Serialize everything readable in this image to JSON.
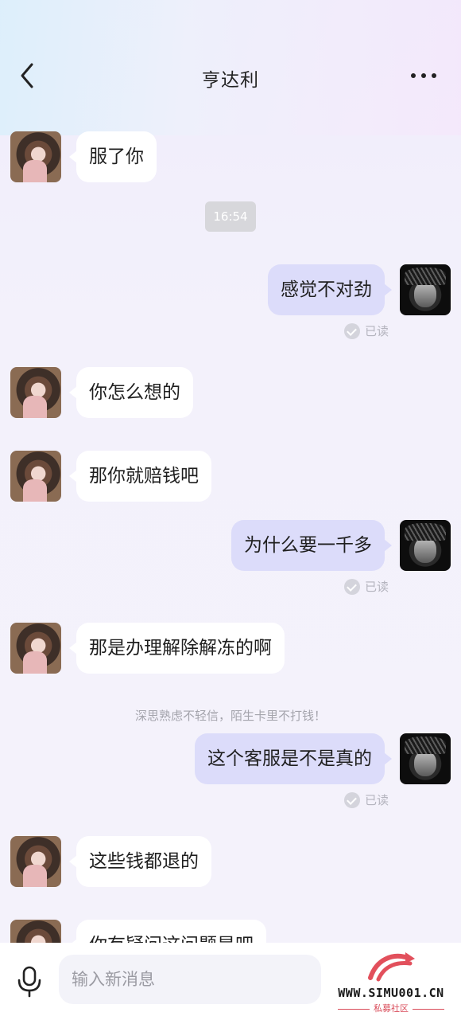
{
  "header": {
    "title": "亨达利"
  },
  "messages": [
    {
      "side": "in",
      "text": "服了你"
    },
    {
      "timestamp": "16:54"
    },
    {
      "side": "out",
      "text": "感觉不对劲",
      "status": "已读"
    },
    {
      "side": "in",
      "text": "你怎么想的"
    },
    {
      "side": "in",
      "text": "那你就赔钱吧"
    },
    {
      "side": "out",
      "text": "为什么要一千多",
      "status": "已读"
    },
    {
      "side": "in",
      "text": "那是办理解除解冻的啊"
    },
    {
      "notice": "深思熟虑不轻信，陌生卡里不打钱！"
    },
    {
      "side": "out",
      "text": "这个客服是不是真的",
      "status": "已读"
    },
    {
      "side": "in",
      "text": "这些钱都退的"
    },
    {
      "side": "in",
      "text": "你有疑问这问题是吧"
    }
  ],
  "composer": {
    "placeholder": "输入新消息"
  },
  "watermark": {
    "url": "WWW.SIMU001.CN",
    "sub": "私募社区"
  },
  "icons": [
    "back-icon",
    "more-icon",
    "mic-icon",
    "read-check-icon"
  ],
  "colors": {
    "outgoing_bubble": "#dcdcfa",
    "incoming_bubble": "#ffffff",
    "composer_bg": "#f3f3f9"
  }
}
